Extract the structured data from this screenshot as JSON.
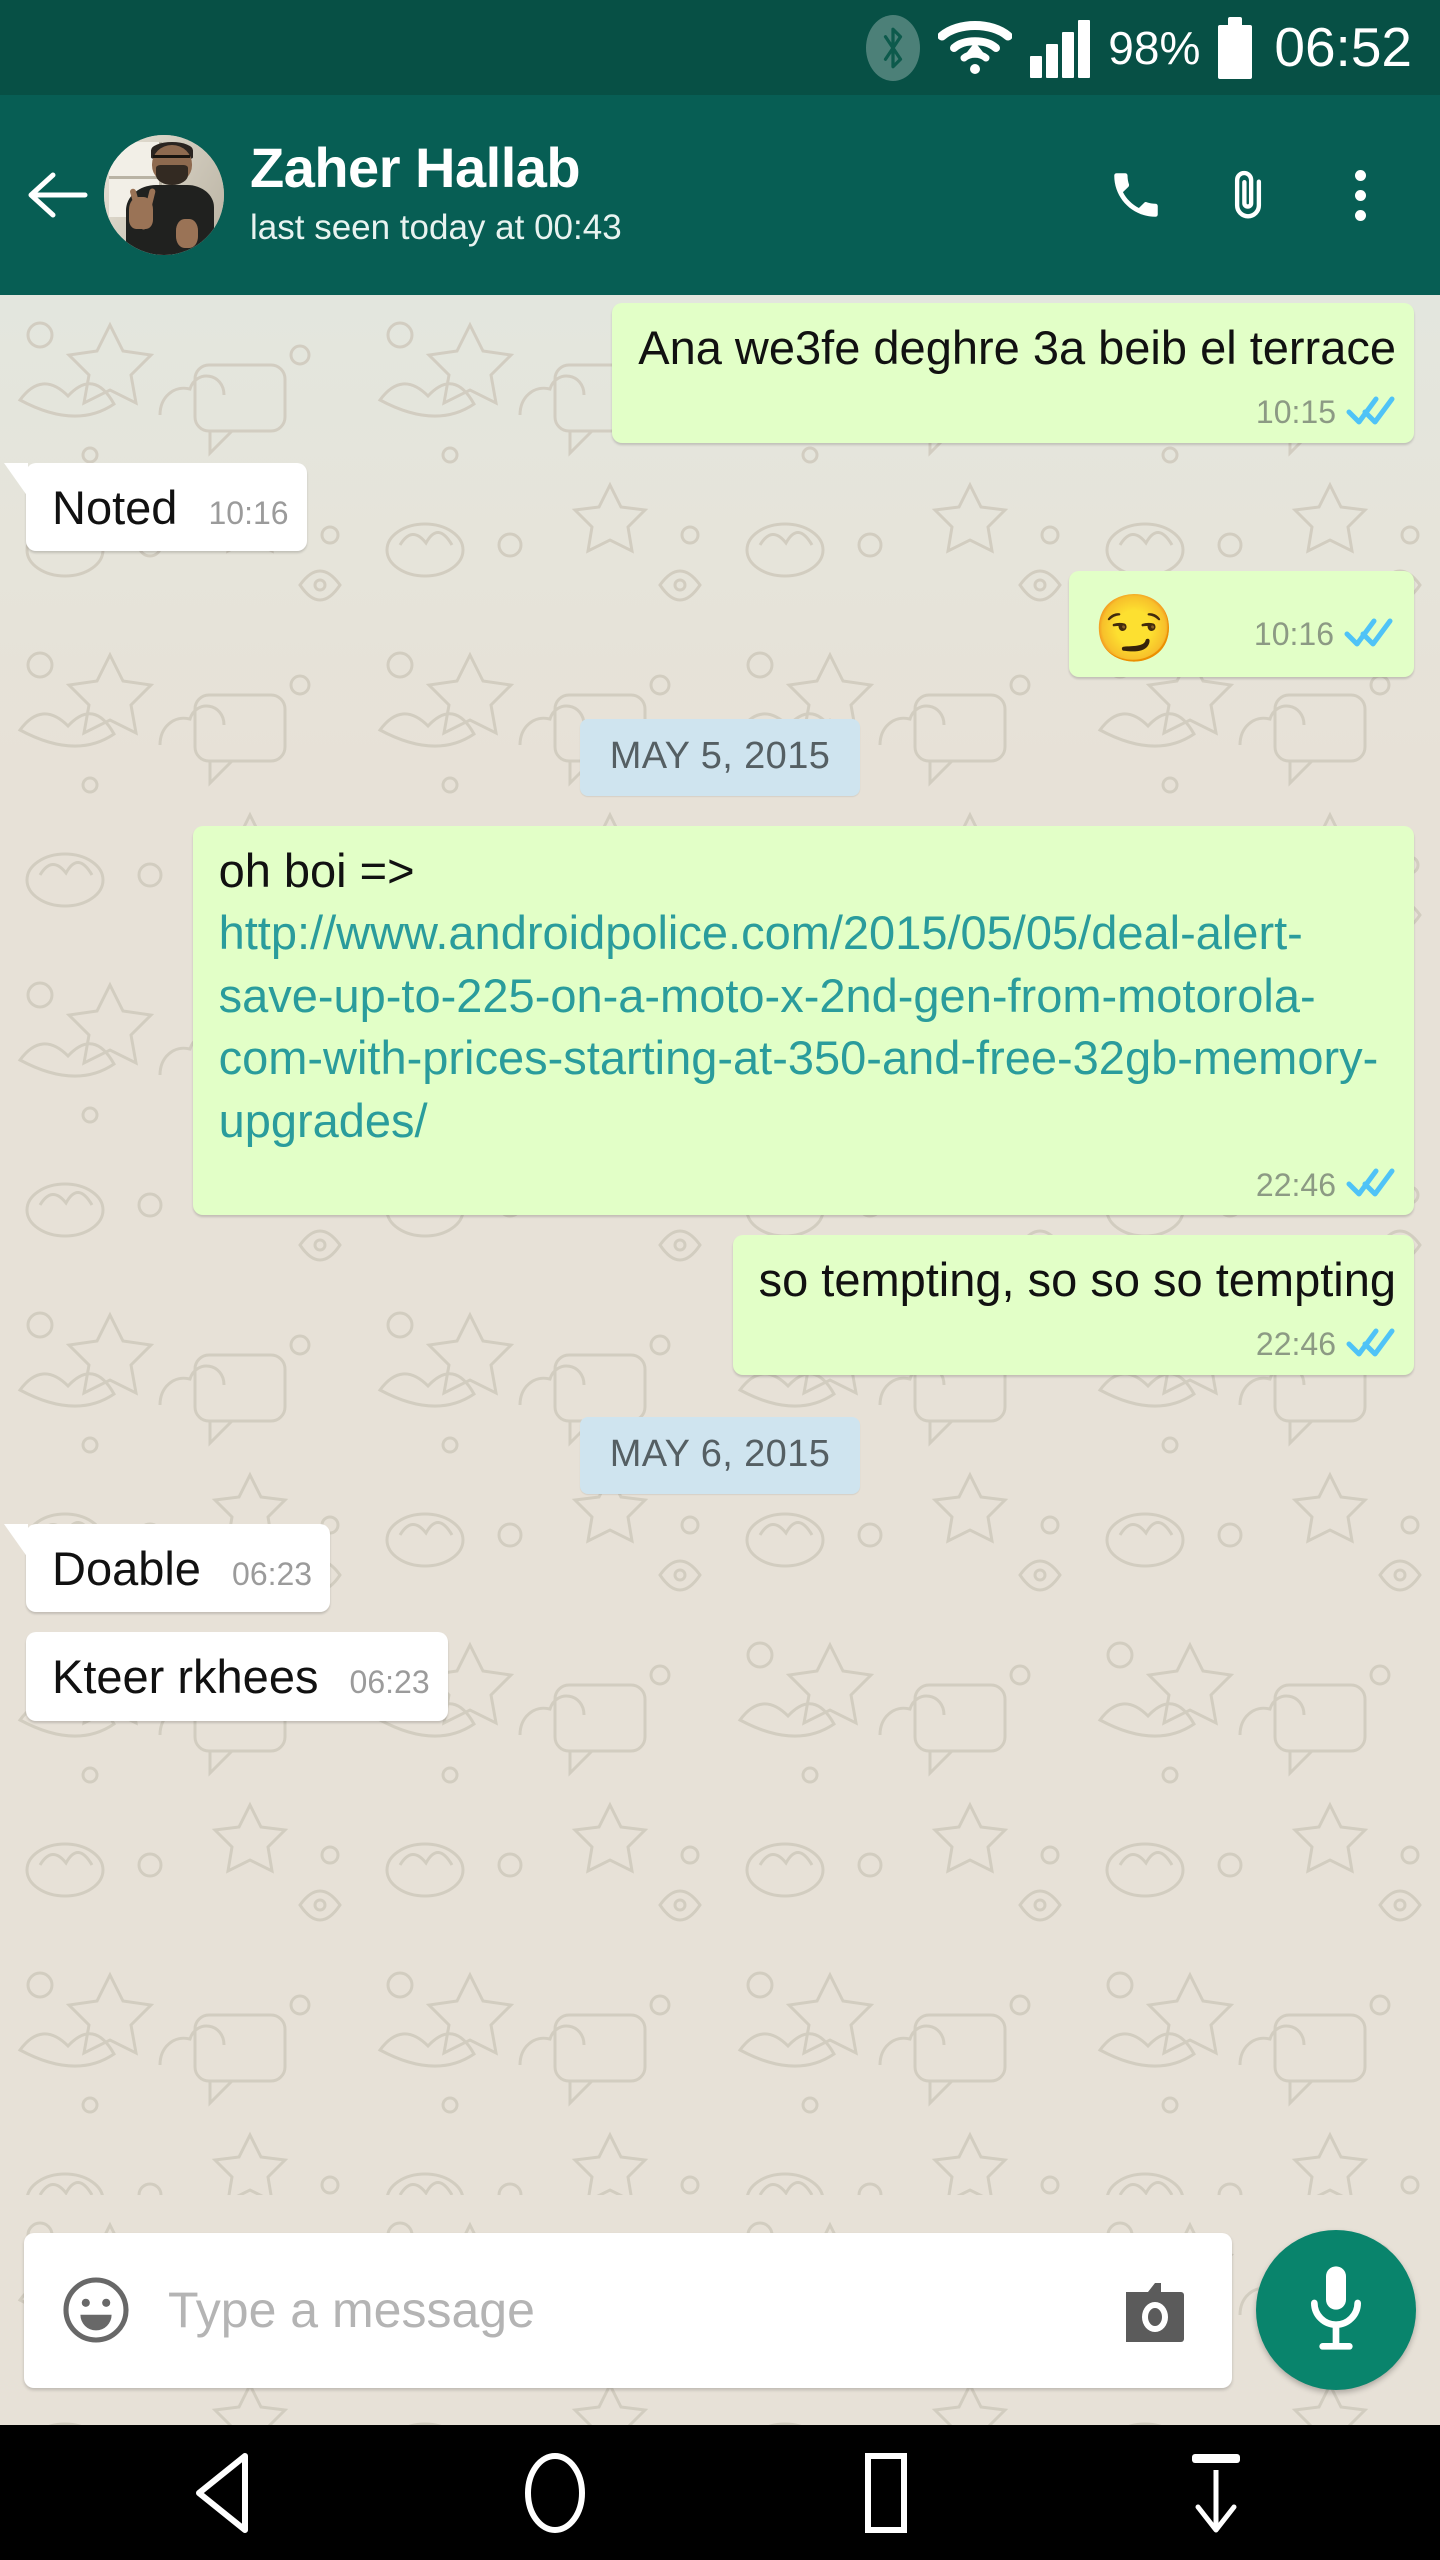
{
  "status_bar": {
    "bluetooth_icon": "bluetooth-icon",
    "wifi_icon": "wifi-icon",
    "signal_icon": "signal-bars-icon",
    "battery_percent": "98%",
    "battery_icon": "battery-icon",
    "clock": "06:52"
  },
  "app_bar": {
    "back_icon": "back-arrow-icon",
    "avatar": "contact-avatar",
    "contact_name": "Zaher Hallab",
    "contact_status": "last seen today at 00:43",
    "call_icon": "phone-icon",
    "attach_icon": "paperclip-icon",
    "overflow_icon": "more-options-icon"
  },
  "colors": {
    "status_bar": "#075045",
    "app_bar": "#075e54",
    "outgoing_bubble": "#e2ffc7",
    "incoming_bubble": "#ffffff",
    "chat_background": "#e7e1d7",
    "date_pill": "#cfe4ef",
    "link": "#2a9c9c",
    "read_tick": "#4fc3f7",
    "mic_fab": "#09846c"
  },
  "messages": [
    {
      "id": "msg-ana-we3fe",
      "type": "text",
      "direction": "out",
      "text": "Ana we3fe deghre 3a beib el terrace",
      "time": "10:15",
      "status": "read"
    },
    {
      "id": "msg-noted",
      "type": "text",
      "direction": "in",
      "text": "Noted",
      "time": "10:16",
      "status": "none"
    },
    {
      "id": "msg-smirk",
      "type": "emoji",
      "direction": "out",
      "text": "😏",
      "time": "10:16",
      "status": "read"
    },
    {
      "id": "date-may-5",
      "type": "date",
      "text": "MAY 5, 2015"
    },
    {
      "id": "msg-oh-boi",
      "type": "link",
      "direction": "out",
      "prefix": "oh boi => ",
      "link_text": "http://www.androidpolice.com/2015/05/05/deal-alert-save-up-to-225-on-a-moto-x-2nd-gen-from-motorola-com-with-prices-starting-at-350-and-free-32gb-memory-upgrades/",
      "time": "22:46",
      "status": "read"
    },
    {
      "id": "msg-so-tempting",
      "type": "text",
      "direction": "out",
      "text": "so tempting, so so so tempting",
      "time": "22:46",
      "status": "read"
    },
    {
      "id": "date-may-6",
      "type": "date",
      "text": "MAY 6, 2015"
    },
    {
      "id": "msg-doable",
      "type": "text",
      "direction": "in",
      "text": "Doable",
      "time": "06:23",
      "status": "none"
    },
    {
      "id": "msg-kteer-rkhees",
      "type": "text",
      "direction": "in",
      "text": "Kteer rkhees",
      "time": "06:23",
      "status": "none"
    }
  ],
  "composer": {
    "emoji_icon": "emoji-smiley-icon",
    "placeholder": "Type a message",
    "value": "",
    "camera_icon": "camera-icon",
    "mic_icon": "microphone-icon"
  },
  "nav_bar": {
    "back_icon": "nav-back-icon",
    "home_icon": "nav-home-icon",
    "recents_icon": "nav-recents-icon",
    "hide_icon": "nav-hide-keyboard-icon"
  }
}
